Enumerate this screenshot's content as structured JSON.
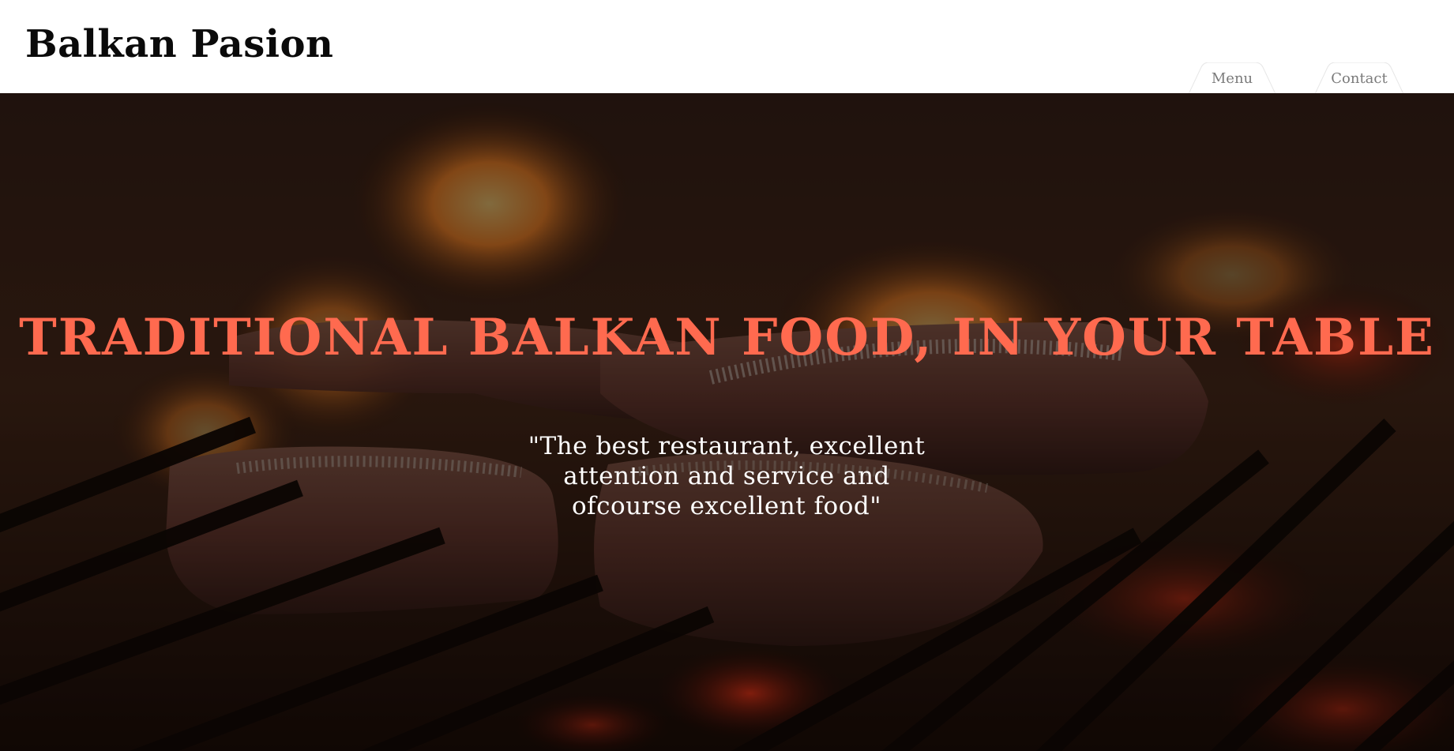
{
  "header": {
    "brand": "Balkan Pasion"
  },
  "nav": {
    "items": [
      {
        "label": "Menu"
      },
      {
        "label": "Contact"
      }
    ]
  },
  "hero": {
    "headline": "TRADITIONAL BALKAN FOOD, IN YOUR TABLE",
    "quote": "\"The best restaurant, excellent attention and service and ofcourse excellent food\"",
    "background": "grilled-steaks-over-fire-photo",
    "colors": {
      "headline": "#ff6a4f",
      "quote": "#ffffff",
      "brand": "#0a0a0a",
      "nav_text": "#7a7a7a"
    }
  }
}
